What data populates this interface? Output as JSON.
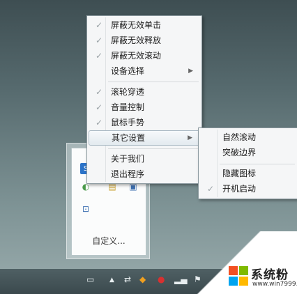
{
  "menu": {
    "items": [
      {
        "label": "屏蔽无效单击",
        "checked": true
      },
      {
        "label": "屏蔽无效释放",
        "checked": true
      },
      {
        "label": "屏蔽无效滚动",
        "checked": true
      },
      {
        "label": "设备选择",
        "checked": false,
        "submenu": true
      },
      {
        "label": "滚轮穿透",
        "checked": true
      },
      {
        "label": "音量控制",
        "checked": true
      },
      {
        "label": "鼠标手势",
        "checked": true
      },
      {
        "label": "其它设置",
        "checked": false,
        "submenu": true,
        "highlighted": true
      },
      {
        "label": "关于我们",
        "checked": false
      },
      {
        "label": "退出程序",
        "checked": false
      }
    ]
  },
  "submenu": {
    "items": [
      {
        "label": "自然滚动",
        "checked": false
      },
      {
        "label": "突破边界",
        "checked": false
      },
      {
        "label": "隐藏图标",
        "checked": false
      },
      {
        "label": "开机启动",
        "checked": true
      }
    ]
  },
  "tray_popup": {
    "customize_label": "自定义..."
  },
  "watermark": {
    "brand": "系统粉",
    "url": "www.win7999.com",
    "colors": [
      "#f25022",
      "#7fba00",
      "#00a4ef",
      "#ffb900"
    ]
  },
  "icons": {
    "check": "✓",
    "arrow": "▶"
  }
}
